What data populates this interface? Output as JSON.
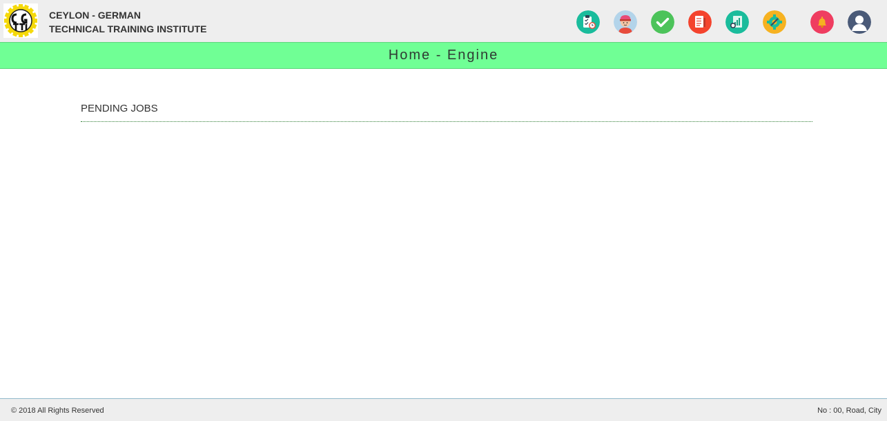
{
  "header": {
    "logo_text": "CGTTI",
    "org_line1": "CEYLON - GERMAN",
    "org_line2": "TECHNICAL TRAINING INSTITUTE",
    "nav_icons": [
      {
        "name": "clipboard-clock-icon",
        "color": "#1abc9c"
      },
      {
        "name": "mechanic-avatar-icon",
        "color": "#b3d4ea"
      },
      {
        "name": "checkmark-icon",
        "color": "#4cc35a"
      },
      {
        "name": "document-list-icon",
        "color": "#f4432d"
      },
      {
        "name": "chart-report-icon",
        "color": "#1abc9c"
      },
      {
        "name": "gear-wrench-icon",
        "color": "#f6b221"
      },
      {
        "name": "notification-bell-icon",
        "color": "#ef3d60"
      },
      {
        "name": "user-profile-icon",
        "color": "#4a5a78"
      }
    ]
  },
  "page": {
    "title": "Home - Engine"
  },
  "main": {
    "section_heading": "PENDING JOBS"
  },
  "footer": {
    "copyright": "© 2018 All Rights Reserved",
    "address": "No : 00, Road, City"
  },
  "colors": {
    "title_bar": "#70ff95",
    "header_bg": "#eeeeee"
  }
}
